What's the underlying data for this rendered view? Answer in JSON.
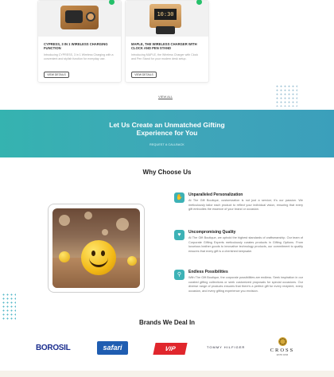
{
  "products": [
    {
      "title": "CYPRESS, 3 IN 1 WIRELESS CHARGING FUNCTION",
      "description": "Introducing CYPRESS, 3 in 1 Wireless Charging with a convenient and stylish function for everyday use.",
      "button_label": "VIEW DETAILS"
    },
    {
      "title": "MAPLE, THE WIRELESS CHARGER WITH CLOCK AND PEN STAND",
      "description": "Introducing MAPLE, the Wireless Charger with Clock and Pen Stand for your modern desk setup.",
      "button_label": "VIEW DETAILS",
      "clock_display": "10:30"
    }
  ],
  "pager": {
    "label": "VIEW ALL"
  },
  "banner": {
    "title_line1": "Let Us Create an Unmatched Gifting",
    "title_line2": "Experience for You",
    "cta": "REQUEST A CALLBACK"
  },
  "why": {
    "title": "Why Choose Us",
    "features": [
      {
        "icon": "hand-icon",
        "title": "Unparalleled Personalization",
        "text": "At The Gift Boutique, customization is not just a service; it's our passion. We meticulously tailor each product to reflect your individual vision, ensuring that every gift embodies the essence of your brand or occasion."
      },
      {
        "icon": "heart-icon",
        "title": "Uncompromising Quality",
        "text": "At The Gift Boutique, we uphold the highest standards of craftsmanship. Our team of Corporate Gifting Experts meticulously curates products in Gifting Options. From luxurious leather goods to innovative technology products, our commitment to quality ensures that every gift is a cherished keepsake."
      },
      {
        "icon": "gift-icon",
        "title": "Endless Possibilities",
        "text": "With The Gift Boutique, the corporate possibilities are endless. Seek inspiration in our curated gifting collections or seek customized proposals for special occasions. Our diverse range of products ensures that there's a perfect gift for every recipient, every occasion, and every gifting experience you envision."
      }
    ]
  },
  "brands": {
    "title": "Brands We Deal In",
    "items": [
      "BOROSIL",
      "safari",
      "VIP",
      "TOMMY HILFIGER",
      "CROSS"
    ],
    "cross_tagline": "ESTD 1846"
  },
  "colors": {
    "accent": "#3db2b6",
    "banner_start": "#35b3b0",
    "banner_end": "#3b9fbb",
    "borosil": "#1b2e8f",
    "safari": "#1f5db1",
    "vip": "#e0262c"
  }
}
